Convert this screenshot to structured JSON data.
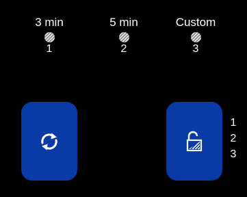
{
  "colors": {
    "background": "#000000",
    "button_blue": "#0a3aa6",
    "text": "#ffffff"
  },
  "presets": [
    {
      "label": "3 min",
      "number": "1",
      "icon": "hatched-dot-icon"
    },
    {
      "label": "5 min",
      "number": "2",
      "icon": "hatched-dot-icon"
    },
    {
      "label": "Custom",
      "number": "3",
      "icon": "hatched-dot-icon"
    }
  ],
  "buttons": {
    "refresh": {
      "icon": "refresh-icon"
    },
    "unlock": {
      "icon": "unlock-icon"
    }
  },
  "levels": [
    "1",
    "2",
    "3"
  ]
}
